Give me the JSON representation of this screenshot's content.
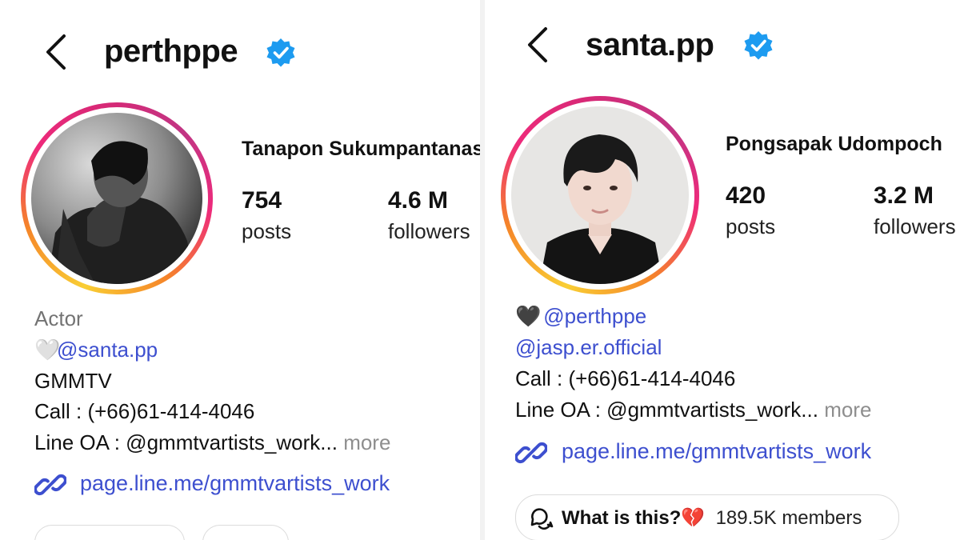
{
  "left": {
    "handle": "perthppe",
    "full_name": "Tanapon Sukumpantanasan",
    "stats": {
      "posts": {
        "value": "754",
        "label": "posts"
      },
      "followers": {
        "value": "4.6 M",
        "label": "followers"
      }
    },
    "bio": {
      "category": "Actor",
      "emoji": "🤍",
      "mention": "@santa.pp",
      "line_agency": "GMMTV",
      "line_call": "Call : (+66)61-414-4046",
      "line_oa": "Line OA : @gmmtvartists_work...",
      "more": "more"
    },
    "link": "page.line.me/gmmtvartists_work"
  },
  "right": {
    "handle": "santa.pp",
    "full_name": "Pongsapak Udompoch",
    "stats": {
      "posts": {
        "value": "420",
        "label": "posts"
      },
      "followers": {
        "value": "3.2 M",
        "label": "followers"
      }
    },
    "bio": {
      "emoji": "🖤",
      "mention1": "@perthppe",
      "mention2": "@jasp.er.official",
      "line_call": "Call : (+66)61-414-4046",
      "line_oa": "Line OA : @gmmtvartists_work...",
      "more": "more"
    },
    "link": "page.line.me/gmmtvartists_work",
    "channel": {
      "title": "What is this?",
      "emoji": "💔",
      "members": "189.5K members"
    }
  },
  "icons": {
    "back": "chevron-left-icon",
    "verified": "verified-badge-icon",
    "link": "link-chain-icon",
    "channel": "chat-bubbles-icon"
  },
  "colors": {
    "verified_blue": "#1d9bf0",
    "link_blue": "#3d4fcf",
    "muted_gray": "#737373"
  }
}
